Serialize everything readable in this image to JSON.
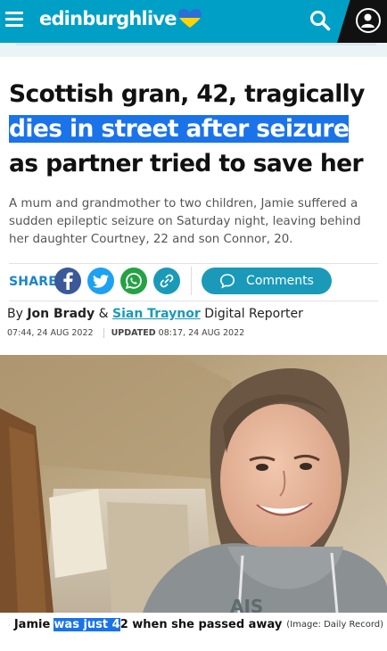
{
  "header": {
    "logo_text": "edinburghlive",
    "menu_icon": "hamburger-menu-icon",
    "search_icon": "search-icon",
    "account_icon": "account-icon",
    "brand_color": "#00a0c6"
  },
  "article": {
    "headline_part1": "Scottish gran, 42, tragically",
    "headline_highlight": "dies in street after seizure",
    "headline_part2": "as partner tried to save her",
    "standfirst": "A mum and grandmother to two children, Jamie suffered a sudden epileptic seizure on Saturday night, leaving behind her daughter Courtney, 22 and son Connor, 20.",
    "share_label": "SHARE",
    "comments_label": "Comments",
    "byline": {
      "by": "By",
      "author1": "Jon Brady",
      "amp": "&",
      "author2": "Sian Traynor",
      "role": "Digital Reporter"
    },
    "published": "07:44, 24 AUG 2022",
    "updated_label": "UPDATED",
    "updated": "08:17, 24 AUG 2022",
    "caption": {
      "part1": "Jamie",
      "highlight": "was just 4",
      "part2": "2 when she passed away",
      "credit": "(Image: Daily Record)"
    }
  },
  "colors": {
    "highlight": "#1a73e8",
    "facebook": "#3b5998",
    "twitter": "#1da1f2",
    "whatsapp": "#25a244",
    "link": "#1a9ab8"
  }
}
